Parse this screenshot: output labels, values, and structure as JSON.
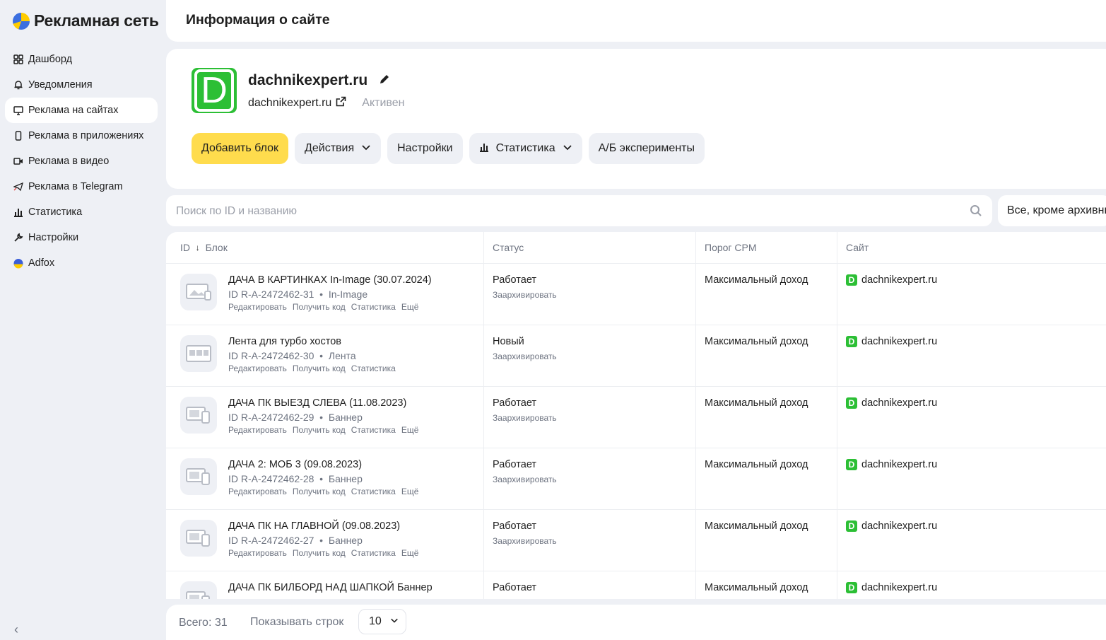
{
  "app": {
    "name": "Рекламная сеть"
  },
  "sidebar": {
    "items": [
      {
        "label": "Дашборд",
        "icon": "grid-icon",
        "active": false
      },
      {
        "label": "Уведомления",
        "icon": "bell-icon",
        "active": false
      },
      {
        "label": "Реклама на сайтах",
        "icon": "monitor-icon",
        "active": true
      },
      {
        "label": "Реклама в приложениях",
        "icon": "phone-icon",
        "active": false
      },
      {
        "label": "Реклама в видео",
        "icon": "video-icon",
        "active": false
      },
      {
        "label": "Реклама в Telegram",
        "icon": "telegram-icon",
        "active": false
      },
      {
        "label": "Статистика",
        "icon": "chart-icon",
        "active": false
      },
      {
        "label": "Настройки",
        "icon": "wrench-icon",
        "active": false
      },
      {
        "label": "Adfox",
        "icon": "adfox-icon",
        "active": false
      }
    ],
    "collapse": "‹"
  },
  "header": {
    "title": "Информация о сайте"
  },
  "site": {
    "favicon_letter": "D",
    "name": "dachnikexpert.ru",
    "domain": "dachnikexpert.ru",
    "status": "Активен"
  },
  "actions": {
    "add_block": "Добавить блок",
    "actions": "Действия",
    "settings": "Настройки",
    "statistics": "Статистика",
    "ab": "А/Б эксперименты"
  },
  "search": {
    "placeholder": "Поиск по ID и названию"
  },
  "filter": {
    "value": "Все, кроме архивных"
  },
  "table": {
    "headers": {
      "id": "ID",
      "sort": "↓",
      "block": "Блок",
      "status": "Статус",
      "cpm": "Порог CPM",
      "site": "Сайт"
    },
    "rows": [
      {
        "name": "ДАЧА В КАРТИНКАХ In-Image (30.07.2024)",
        "id": "ID R-A-2472462-31",
        "type": "In-Image",
        "links": [
          "Редактировать",
          "Получить код",
          "Статистика",
          "Ещё"
        ],
        "status": "Работает",
        "status_action": "Заархивировать",
        "cpm": "Максимальный доход",
        "site": "dachnikexpert.ru"
      },
      {
        "name": "Лента для турбо хостов",
        "id": "ID R-A-2472462-30",
        "type": "Лента",
        "links": [
          "Редактировать",
          "Получить код",
          "Статистика"
        ],
        "status": "Новый",
        "status_action": "Заархивировать",
        "cpm": "Максимальный доход",
        "site": "dachnikexpert.ru"
      },
      {
        "name": "ДАЧА ПК ВЫЕЗД СЛЕВА (11.08.2023)",
        "id": "ID R-A-2472462-29",
        "type": "Баннер",
        "links": [
          "Редактировать",
          "Получить код",
          "Статистика",
          "Ещё"
        ],
        "status": "Работает",
        "status_action": "Заархивировать",
        "cpm": "Максимальный доход",
        "site": "dachnikexpert.ru"
      },
      {
        "name": "ДАЧА 2: МОБ 3 (09.08.2023)",
        "id": "ID R-A-2472462-28",
        "type": "Баннер",
        "links": [
          "Редактировать",
          "Получить код",
          "Статистика",
          "Ещё"
        ],
        "status": "Работает",
        "status_action": "Заархивировать",
        "cpm": "Максимальный доход",
        "site": "dachnikexpert.ru"
      },
      {
        "name": "ДАЧА ПК НА ГЛАВНОЙ (09.08.2023)",
        "id": "ID R-A-2472462-27",
        "type": "Баннер",
        "links": [
          "Редактировать",
          "Получить код",
          "Статистика",
          "Ещё"
        ],
        "status": "Работает",
        "status_action": "Заархивировать",
        "cpm": "Максимальный доход",
        "site": "dachnikexpert.ru"
      },
      {
        "name": "ДАЧА ПК БИЛБОРД НАД ШАПКОЙ Баннер",
        "id": "",
        "type": "",
        "links": [],
        "status": "Работает",
        "status_action": "",
        "cpm": "Максимальный доход",
        "site": "dachnikexpert.ru"
      }
    ]
  },
  "footer": {
    "total": "Всего: 31",
    "rows_label": "Показывать строк",
    "rows_value": "10"
  }
}
